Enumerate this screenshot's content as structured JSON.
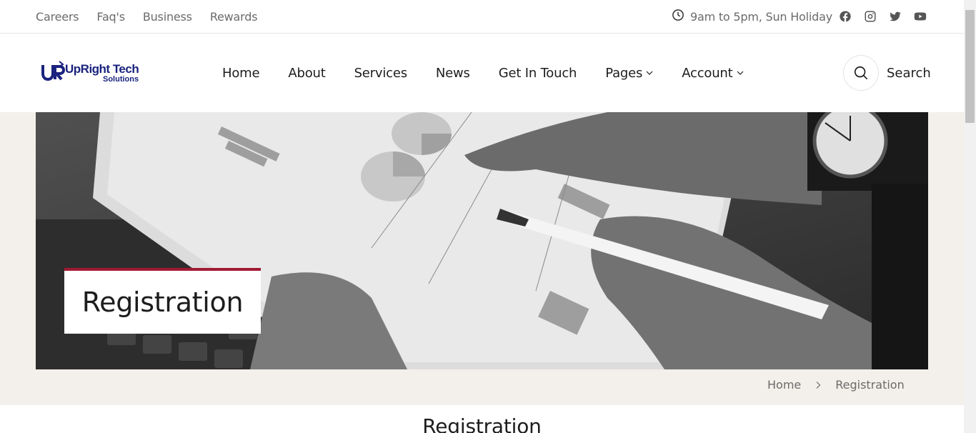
{
  "topbar": {
    "links": [
      "Careers",
      "Faq's",
      "Business",
      "Rewards"
    ],
    "hours": "9am to 5pm, Sun Holiday",
    "socials": [
      "facebook-icon",
      "instagram-icon",
      "twitter-icon",
      "youtube-icon"
    ]
  },
  "header": {
    "logo": {
      "mark": "UR",
      "name": "UpRight Tech",
      "sub": "Solutions",
      "color": "#1a237e"
    },
    "nav": [
      "Home",
      "About",
      "Services",
      "News",
      "Get In Touch",
      "Pages",
      "Account"
    ],
    "search_label": "Search"
  },
  "hero": {
    "title": "Registration",
    "accent_color": "#a11a34",
    "background_color": "#f3efea"
  },
  "breadcrumb": {
    "home": "Home",
    "current": "Registration"
  },
  "section": {
    "title": "Registration"
  }
}
